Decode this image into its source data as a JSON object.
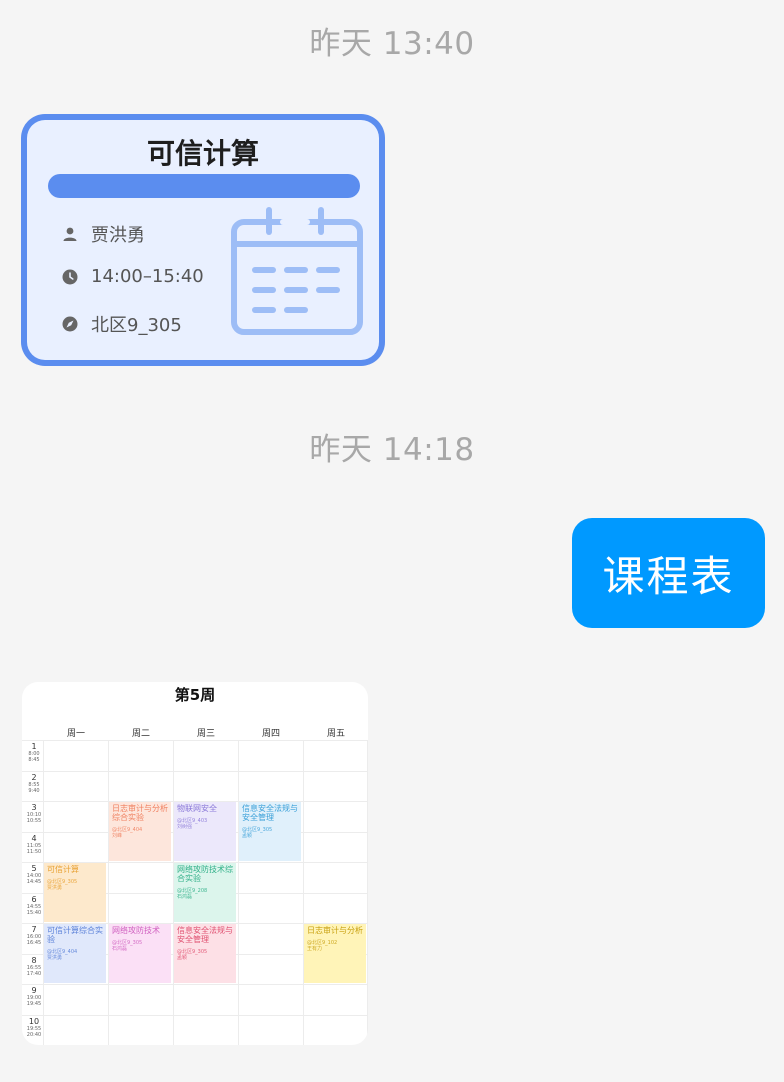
{
  "messages": {
    "timestamp_1": "昨天 13:40",
    "timestamp_2": "昨天 14:18",
    "sent_text": "课程表"
  },
  "course_card": {
    "title": "可信计算",
    "teacher": "贾洪勇",
    "time": "14:00–15:40",
    "location": "北区9_305",
    "colors": {
      "accent": "#5b8def",
      "background": "#e9f0ff"
    },
    "icons": [
      "person-icon",
      "clock-icon",
      "compass-icon",
      "calendar-icon"
    ]
  },
  "schedule": {
    "title": "第5周",
    "days": [
      "周一",
      "周二",
      "周三",
      "周四",
      "周五"
    ],
    "slots": [
      {
        "n": "1",
        "start": "8:00",
        "end": "8:45"
      },
      {
        "n": "2",
        "start": "8:55",
        "end": "9:40"
      },
      {
        "n": "3",
        "start": "10:10",
        "end": "10:55"
      },
      {
        "n": "4",
        "start": "11:05",
        "end": "11:50"
      },
      {
        "n": "5",
        "start": "14:00",
        "end": "14:45"
      },
      {
        "n": "6",
        "start": "14:55",
        "end": "15:40"
      },
      {
        "n": "7",
        "start": "16:00",
        "end": "16:45"
      },
      {
        "n": "8",
        "start": "16:55",
        "end": "17:40"
      },
      {
        "n": "9",
        "start": "19:00",
        "end": "19:45"
      },
      {
        "n": "10",
        "start": "19:55",
        "end": "20:40"
      }
    ],
    "courses": [
      {
        "name": "日志审计与分析综合实验",
        "loc": "@北区9_404",
        "teacher": "刘峰",
        "color": "#f08060",
        "bg": "#fde6dc"
      },
      {
        "name": "物联网安全",
        "loc": "@北区9_403",
        "teacher": "刘树强",
        "color": "#8a78d8",
        "bg": "#ece8fb"
      },
      {
        "name": "信息安全法规与安全管理",
        "loc": "@北区9_305",
        "teacher": "孟颖",
        "color": "#3aa0d8",
        "bg": "#e0f0fb"
      },
      {
        "name": "可信计算",
        "loc": "@北区9_305",
        "teacher": "贾洪勇",
        "color": "#e8a030",
        "bg": "#fde9cc"
      },
      {
        "name": "网络攻防技术综合实验",
        "loc": "@北区9_208",
        "teacher": "石鸿磊",
        "color": "#30b088",
        "bg": "#dcf5ec"
      },
      {
        "name": "可信计算综合实验",
        "loc": "@北区9_404",
        "teacher": "贾洪勇",
        "color": "#5a80d8",
        "bg": "#e0e8fb"
      },
      {
        "name": "网络攻防技术",
        "loc": "@北区9_305",
        "teacher": "石鸿磊",
        "color": "#d060c0",
        "bg": "#fbe0f6"
      },
      {
        "name": "信息安全法规与安全管理",
        "loc": "@北区9_305",
        "teacher": "孟颖",
        "color": "#e05070",
        "bg": "#fde0e6"
      },
      {
        "name": "日志审计与分析",
        "loc": "@北区9_102",
        "teacher": "王有力",
        "color": "#c8a010",
        "bg": "#fff4b8"
      }
    ]
  }
}
